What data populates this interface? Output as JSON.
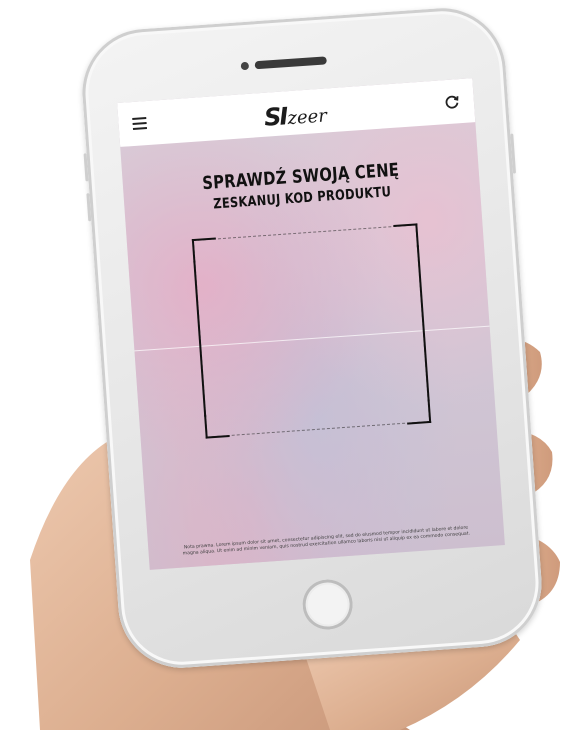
{
  "app": {
    "logo_mark": "SI",
    "logo_text": "zeer"
  },
  "icons": {
    "menu": "hamburger-menu-icon",
    "refresh": "refresh-icon"
  },
  "scanner": {
    "headline": "SPRAWDŹ SWOJĄ CENĘ",
    "subheadline": "ZESKANUJ KOD PRODUKTU"
  },
  "footer": {
    "text": "Nota prawna. Lorem ipsum dolor sit amet, consectetur adipiscing elit, sed do eiusmod tempor incididunt ut labore et dolore magna aliqua. Ut enim ad minim veniam, quis nostrud exercitation ullamco laboris nisi ut aliquip ex ea commodo consequat."
  },
  "colors": {
    "header_bg": "#ffffff",
    "text": "#111111",
    "frame": "#111111"
  }
}
